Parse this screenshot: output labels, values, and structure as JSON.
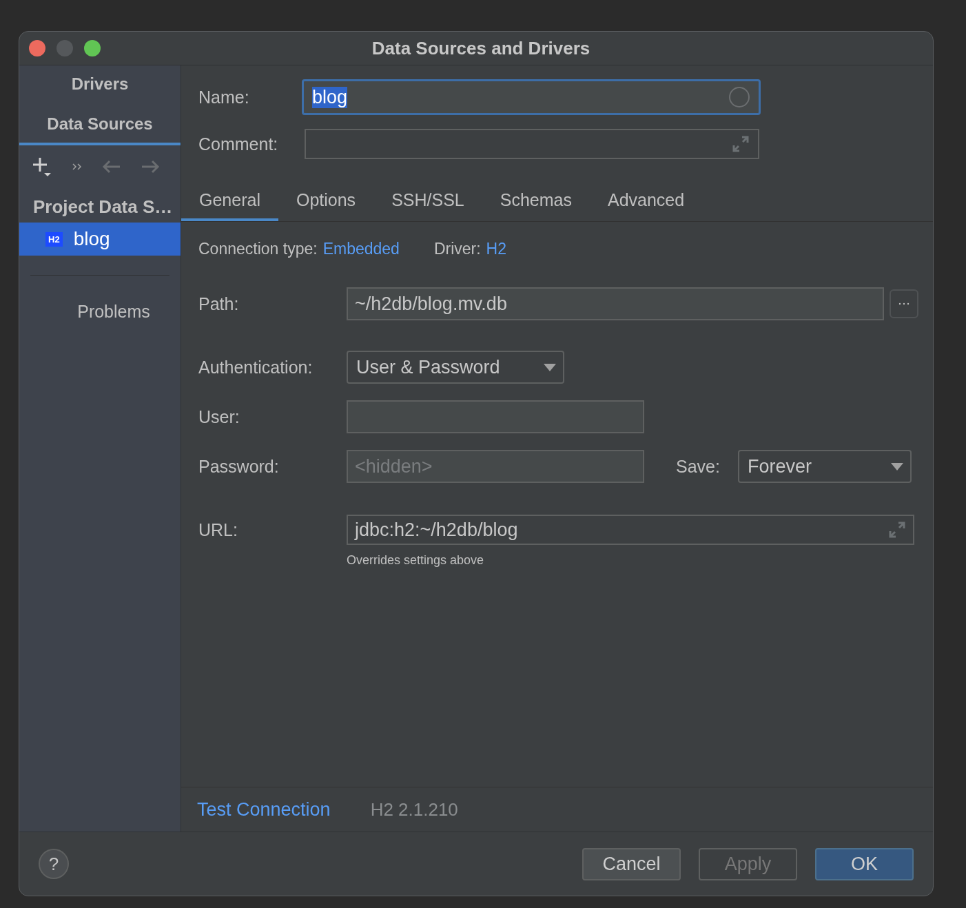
{
  "window": {
    "title": "Data Sources and Drivers"
  },
  "sidebar": {
    "tabs": [
      {
        "label": "Drivers",
        "selected": false
      },
      {
        "label": "Data Sources",
        "selected": true
      }
    ],
    "group": "Project Data S…",
    "items": [
      {
        "badge": "H2",
        "label": "blog",
        "selected": true
      }
    ],
    "problems": "Problems"
  },
  "name": {
    "label": "Name:",
    "value": "blog"
  },
  "comment": {
    "label": "Comment:"
  },
  "tabs": [
    {
      "label": "General",
      "selected": true
    },
    {
      "label": "Options",
      "selected": false
    },
    {
      "label": "SSH/SSL",
      "selected": false
    },
    {
      "label": "Schemas",
      "selected": false
    },
    {
      "label": "Advanced",
      "selected": false
    }
  ],
  "connection": {
    "type_label": "Connection type:",
    "type_value": "Embedded",
    "driver_label": "Driver:",
    "driver_value": "H2"
  },
  "path": {
    "label": "Path:",
    "value": "~/h2db/blog.mv.db"
  },
  "authentication": {
    "label": "Authentication:",
    "value": "User & Password"
  },
  "user": {
    "label": "User:"
  },
  "password": {
    "label": "Password:",
    "placeholder": "<hidden>"
  },
  "save": {
    "label": "Save:",
    "value": "Forever"
  },
  "url": {
    "label": "URL:",
    "value": "jdbc:h2:~/h2db/blog",
    "hint": "Overrides settings above"
  },
  "footer": {
    "test": "Test Connection",
    "version": "H2 2.1.210"
  },
  "help": "?",
  "buttons": [
    {
      "label": "Cancel",
      "kind": "normal"
    },
    {
      "label": "Apply",
      "kind": "disabled"
    },
    {
      "label": "OK",
      "kind": "default"
    }
  ]
}
